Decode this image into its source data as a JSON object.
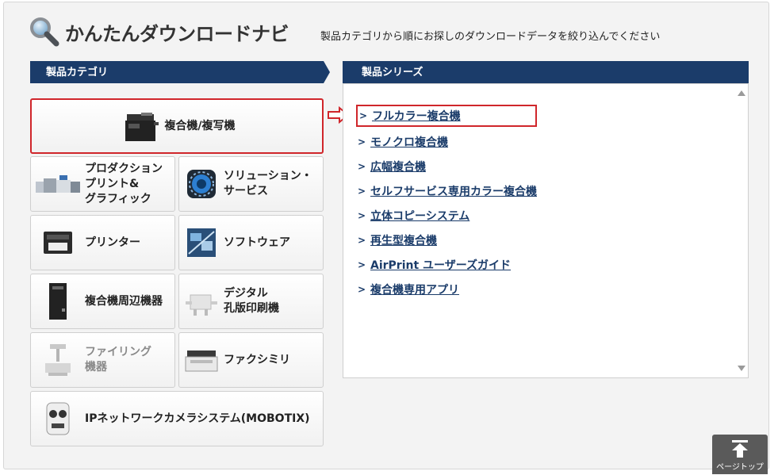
{
  "header": {
    "title": "かんたんダウンロードナビ",
    "subtitle": "製品カテゴリから順にお探しのダウンロードデータを絞り込んでください"
  },
  "categories": {
    "heading": "製品カテゴリ",
    "items": [
      {
        "label": "複合機/複写機",
        "selected": true
      },
      {
        "label_lines": [
          "プロダクション",
          "プリント&",
          "グラフィック"
        ]
      },
      {
        "label_lines": [
          "ソリューション・",
          "サービス"
        ]
      },
      {
        "label": "プリンター"
      },
      {
        "label": "ソフトウェア"
      },
      {
        "label": "複合機周辺機器"
      },
      {
        "label_lines": [
          "デジタル",
          "孔版印刷機"
        ]
      },
      {
        "label_lines": [
          "ファイリング",
          "機器"
        ],
        "dim": true
      },
      {
        "label": "ファクシミリ"
      },
      {
        "label": "IPネットワークカメラシステム(MOBOTIX)"
      }
    ]
  },
  "series": {
    "heading": "製品シリーズ",
    "items": [
      {
        "label": "フルカラー複合機",
        "highlight": true
      },
      {
        "label": "モノクロ複合機"
      },
      {
        "label": "広幅複合機"
      },
      {
        "label": "セルフサービス専用カラー複合機"
      },
      {
        "label": "立体コピーシステム"
      },
      {
        "label": "再生型複合機"
      },
      {
        "label": "AirPrint ユーザーズガイド"
      },
      {
        "label": "複合機専用アプリ"
      }
    ]
  },
  "pagetop": {
    "label": "ページトップ"
  },
  "colors": {
    "navy": "#1b3c6a",
    "highlight_red": "#d0262b",
    "pagetop_gray": "#5a5a5a"
  }
}
